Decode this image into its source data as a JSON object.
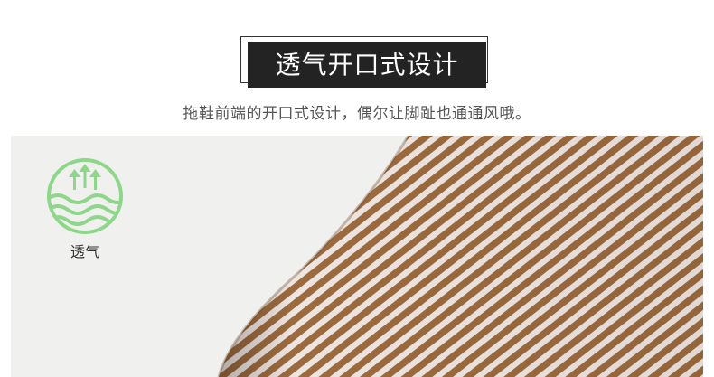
{
  "banner": {
    "title": "透气开口式设计",
    "subtitle": "拖鞋前端的开口式设计，偶尔让脚趾也通通风哦。"
  },
  "feature": {
    "icon": "breathable-arrows-wave-icon",
    "label": "透气",
    "icon_color": "#8dd68a"
  },
  "fabric": {
    "stripe_color_brown": "#9b6a3e",
    "stripe_color_light": "#eee4e0",
    "background_color": "#f0f0ee"
  }
}
